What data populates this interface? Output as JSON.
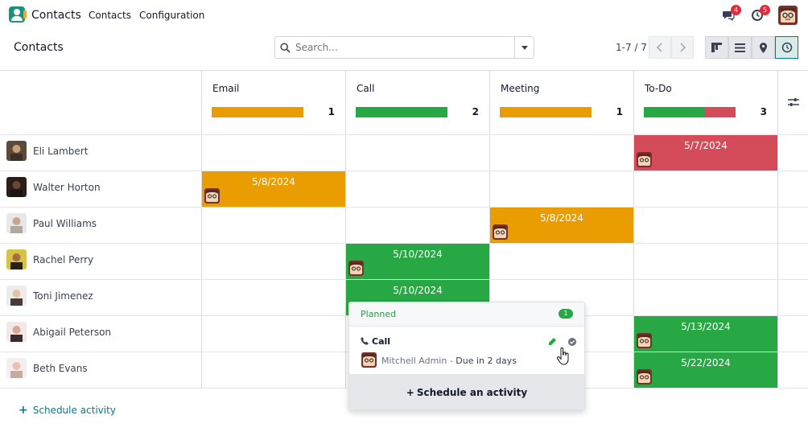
{
  "app": {
    "name": "Contacts"
  },
  "menu": {
    "contacts": "Contacts",
    "configuration": "Configuration"
  },
  "badges": {
    "messages": "4",
    "activities": "5"
  },
  "breadcrumb": "Contacts",
  "search": {
    "placeholder": "Search..."
  },
  "pager": {
    "text": "1-7 / 7"
  },
  "colors": {
    "email": "#e99d00",
    "call": "#28a745",
    "todo_overdue": "#d44c59",
    "accent": "#017e84"
  },
  "columns": [
    {
      "title": "Email",
      "count": "1"
    },
    {
      "title": "Call",
      "count": "2"
    },
    {
      "title": "Meeting",
      "count": "1"
    },
    {
      "title": "To-Do",
      "count": "3"
    }
  ],
  "rows": [
    {
      "name": "Eli Lambert"
    },
    {
      "name": "Walter Horton"
    },
    {
      "name": "Paul Williams"
    },
    {
      "name": "Rachel Perry"
    },
    {
      "name": "Toni Jimenez"
    },
    {
      "name": "Abigail Peterson"
    },
    {
      "name": "Beth Evans"
    }
  ],
  "cells": {
    "eli_todo": "5/7/2024",
    "walter_email": "5/8/2024",
    "paul_meeting": "5/8/2024",
    "rachel_call": "5/10/2024",
    "toni_call": "5/10/2024",
    "abigail_todo": "5/13/2024",
    "beth_todo": "5/22/2024"
  },
  "schedule_link": "Schedule activity",
  "popover": {
    "status": "Planned",
    "count": "1",
    "activity": "Call",
    "user": "Mitchell Admin",
    "due": "Due in 2 days",
    "separator": " - ",
    "footer": "Schedule an activity"
  }
}
